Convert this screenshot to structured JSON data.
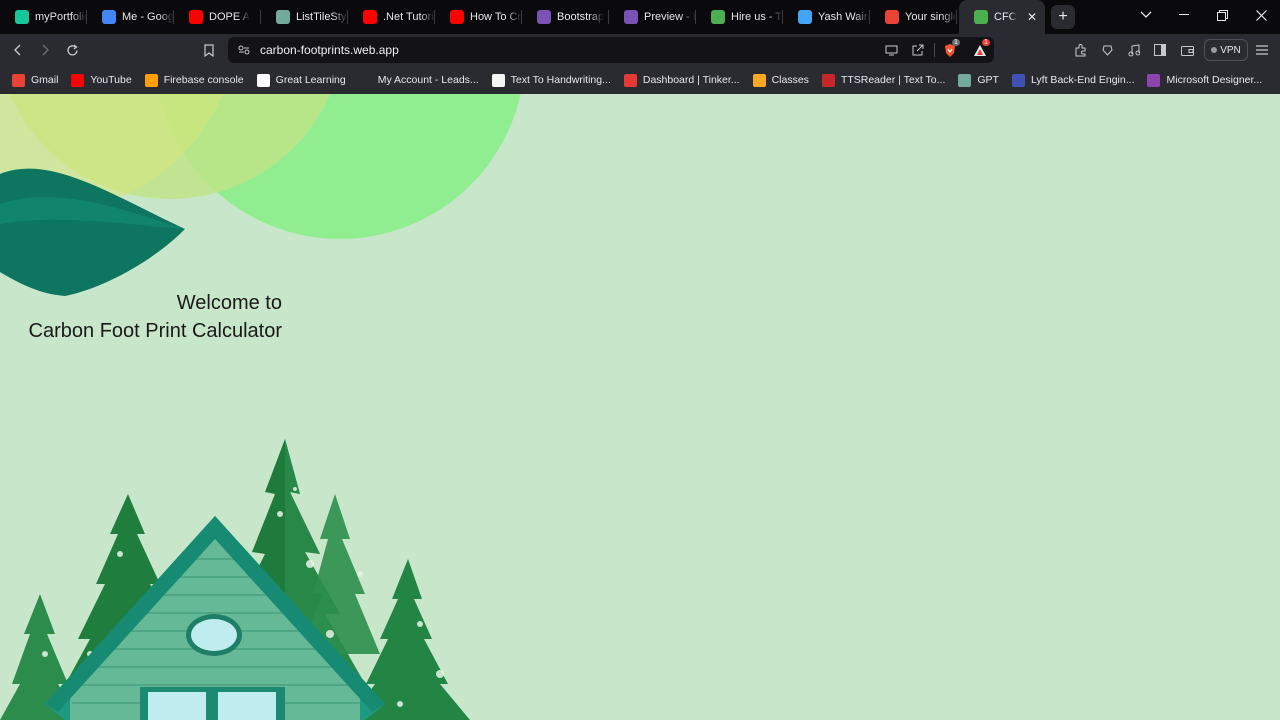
{
  "browser": {
    "tabs": [
      {
        "title": "myPortfolio",
        "icon": "portfolio-icon",
        "color": "#16c79a"
      },
      {
        "title": "Me - Google",
        "icon": "drive-icon",
        "color": "#4285f4"
      },
      {
        "title": "DOPE A",
        "icon": "youtube-icon",
        "color": "#ff0000"
      },
      {
        "title": "ListTileStyle",
        "icon": "chatgpt-icon",
        "color": "#74aa9c"
      },
      {
        "title": ".Net Tutorial",
        "icon": "youtube-icon",
        "color": "#ff0000"
      },
      {
        "title": "How To Cre",
        "icon": "youtube-icon",
        "color": "#ff0000"
      },
      {
        "title": "Bootstrap",
        "icon": "bootstrap-icon",
        "color": "#7952b3"
      },
      {
        "title": "Preview - B",
        "icon": "bootstrap-icon",
        "color": "#7952b3"
      },
      {
        "title": "Hire us - Th",
        "icon": "leaf-icon",
        "color": "#4caf50"
      },
      {
        "title": "Yash Waira",
        "icon": "flutter-icon",
        "color": "#42a5f5"
      },
      {
        "title": "Your single",
        "icon": "gmail-icon",
        "color": "#ea4335"
      },
      {
        "title": "CFC",
        "icon": "cfc-icon",
        "color": "#4caf50",
        "active": true
      }
    ],
    "url": "carbon-footprints.web.app",
    "vpn_label": "VPN",
    "brave_badge": "1",
    "rewards_badge": "1",
    "bookmarks": [
      {
        "label": "Gmail",
        "icon": "gmail-icon",
        "color": "#ea4335"
      },
      {
        "label": "YouTube",
        "icon": "youtube-icon",
        "color": "#ff0000"
      },
      {
        "label": "Firebase console",
        "icon": "firebase-icon",
        "color": "#ffa000"
      },
      {
        "label": "Great Learning",
        "icon": "google-icon",
        "color": "#ffffff"
      },
      {
        "label": "My Account - Leads...",
        "icon": "leads-icon",
        "color": "#2a2a31"
      },
      {
        "label": "Text To Handwriting...",
        "icon": "page-icon",
        "color": "#f5f5f5"
      },
      {
        "label": "Dashboard | Tinker...",
        "icon": "tinkercad-icon",
        "color": "#e53935"
      },
      {
        "label": "Classes",
        "icon": "classroom-icon",
        "color": "#f9a825"
      },
      {
        "label": "TTSReader | Text To...",
        "icon": "speaker-icon",
        "color": "#c62828"
      },
      {
        "label": "GPT",
        "icon": "chatgpt-icon",
        "color": "#74aa9c"
      },
      {
        "label": "Lyft Back-End Engin...",
        "icon": "forage-icon",
        "color": "#3f51b5"
      },
      {
        "label": "Microsoft Designer...",
        "icon": "designer-icon",
        "color": "#8e44ad"
      }
    ]
  },
  "page": {
    "welcome_line": "Welcome to",
    "title_line": "Carbon Foot Print Calculator",
    "background_color": "#c8e6c9"
  }
}
